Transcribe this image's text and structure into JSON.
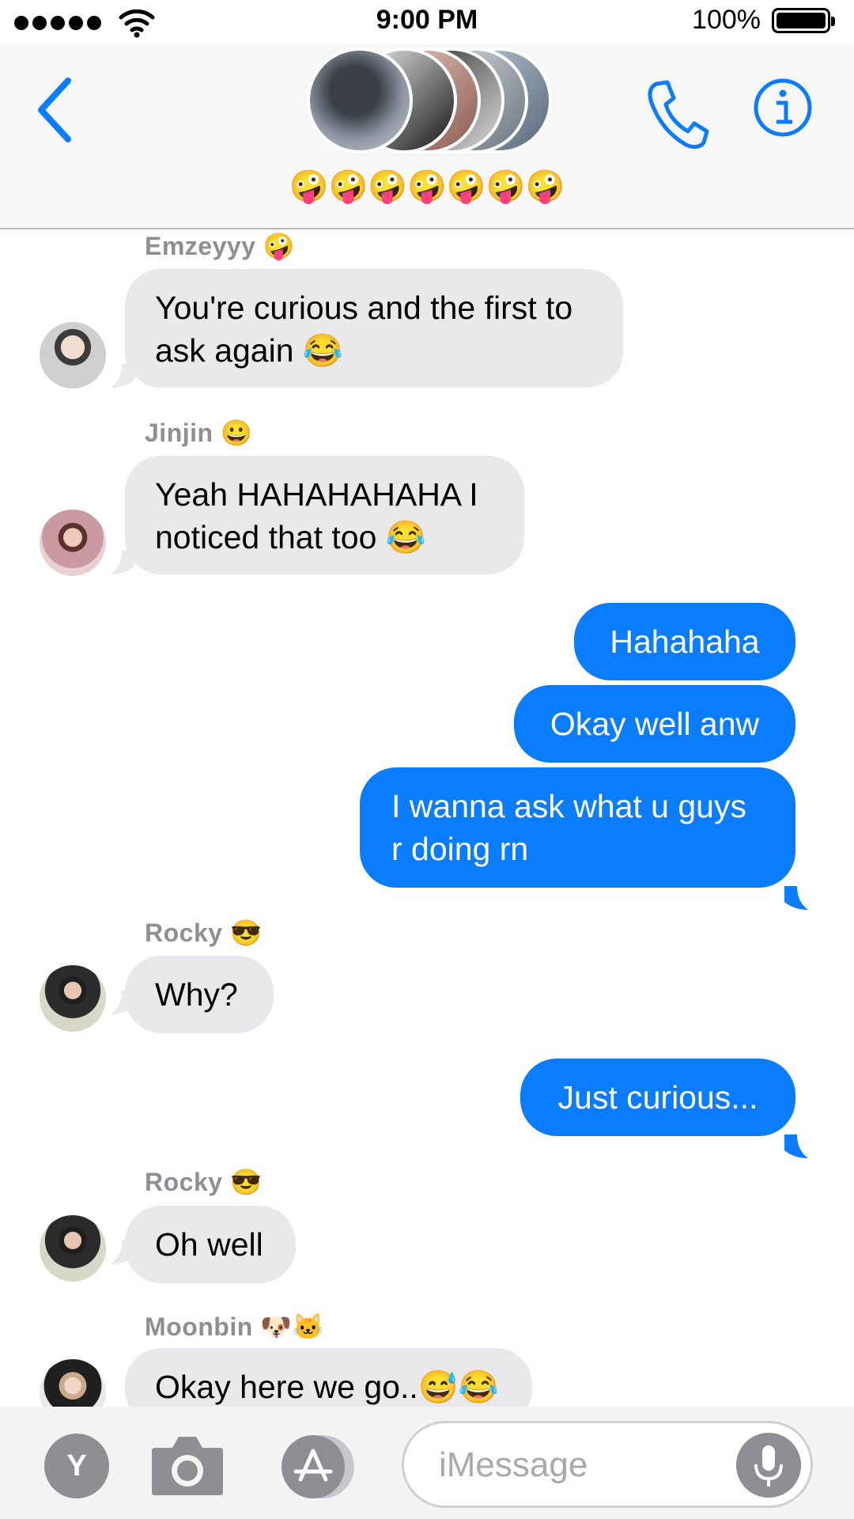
{
  "status_bar": {
    "time": "9:00 PM",
    "battery": "100%"
  },
  "header": {
    "group_name_emojis": "🤪🤪🤪🤪🤪🤪🤪"
  },
  "messages": [
    {
      "sender": "Emzeyyy 🤪",
      "text_lines": [
        "You're curious and the first to",
        "ask again 😂"
      ]
    },
    {
      "sender": "Jinjin 😀",
      "text_lines": [
        "Yeah HAHAHAHAHA I",
        "noticed that too 😂"
      ]
    },
    {
      "text": "Hahahaha"
    },
    {
      "text": "Okay well anw"
    },
    {
      "text_lines": [
        "I wanna ask what u guys",
        "r doing rn"
      ]
    },
    {
      "sender": "Rocky 😎",
      "text": "Why?"
    },
    {
      "text": "Just curious..."
    },
    {
      "sender": "Rocky 😎",
      "text": "Oh well"
    },
    {
      "sender": "Moonbin 🐶🐱",
      "text": "Okay here we go..😅😂"
    }
  ],
  "composer": {
    "apps_initial": "Y",
    "placeholder": "iMessage"
  },
  "colors": {
    "accent": "#0a7cff",
    "incoming_bubble": "#e9e9eb",
    "sender_text": "#8e8e93"
  }
}
